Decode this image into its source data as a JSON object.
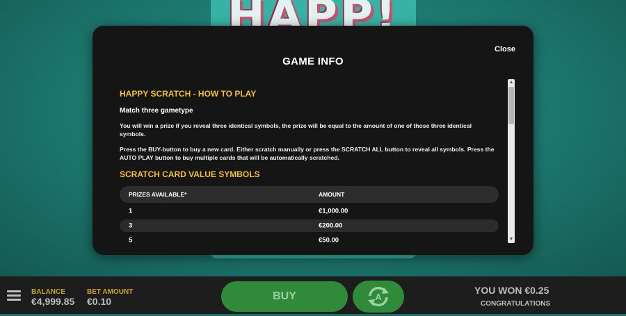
{
  "background": {
    "logo_text": "HAPP!"
  },
  "modal": {
    "close_label": "Close",
    "title": "GAME INFO",
    "section1_heading": "HAPPY SCRATCH - HOW TO PLAY",
    "section1_subheading": "Match three gametype",
    "para1": "You will win a prize if you reveal three identical symbols, the prize will be equal to the amount of one of those three identical symbols.",
    "para2": "Press the BUY-button to buy a new card. Either scratch manually or press the SCRATCH ALL button to reveal all symbols. Press the AUTO PLAY button to buy multiple cards that will be automatically scratched.",
    "section2_heading": "SCRATCH CARD VALUE SYMBOLS",
    "table": {
      "headers": [
        "PRIZES AVAILABLE*",
        "AMOUNT"
      ],
      "rows": [
        [
          "1",
          "€1,000.00"
        ],
        [
          "3",
          "€200.00"
        ],
        [
          "5",
          "€50.00"
        ]
      ]
    }
  },
  "bottom_bar": {
    "balance_label": "BALANCE",
    "balance_value": "€4,999.85",
    "bet_label": "BET AMOUNT",
    "bet_value": "€0.10",
    "buy_label": "BUY",
    "won_text": "YOU WON €0.25",
    "congrats_text": "CONGRATULATIONS"
  },
  "icons": {
    "menu": "menu-icon",
    "autoplay": "autoplay-icon"
  },
  "colors": {
    "accent_gold": "#f2c12e",
    "buy_green": "#2f8a3a",
    "background_teal": "#1e7d73"
  }
}
